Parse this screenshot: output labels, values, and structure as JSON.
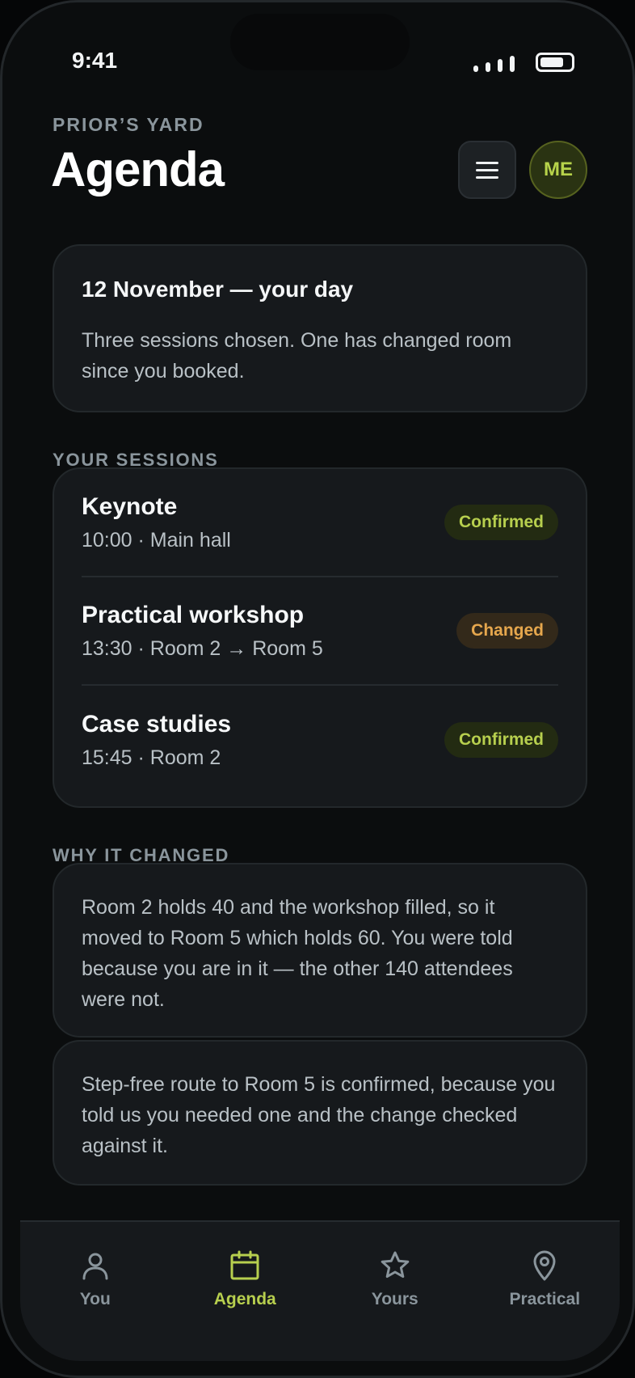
{
  "status_bar": {
    "time": "9:41"
  },
  "header": {
    "eyebrow": "PRIOR’S YARD",
    "title": "Agenda",
    "avatar_initials": "ME"
  },
  "summary": {
    "title": "12 November — your day",
    "text": "Three sessions chosen. One has changed room since you booked."
  },
  "sessions_section": {
    "label": "YOUR SESSIONS",
    "items": [
      {
        "name": "Keynote",
        "meta": "10:00 · Main hall",
        "status": "Confirmed",
        "status_type": "confirmed"
      },
      {
        "name": "Practical workshop",
        "meta": "13:30 · Room 2 → Room 5",
        "status": "Changed",
        "status_type": "changed"
      },
      {
        "name": "Case studies",
        "meta": "15:45 · Room 2",
        "status": "Confirmed",
        "status_type": "confirmed"
      }
    ]
  },
  "why_section": {
    "label": "WHY IT CHANGED",
    "notes": [
      "Room 2 holds 40 and the workshop filled, so it moved to Room 5 which holds 60. You were told because you are in it — the other 140 attendees were not.",
      "Step-free route to Room 5 is confirmed, because you told us you needed one and the change checked against it."
    ]
  },
  "tab_bar": {
    "tabs": [
      {
        "label": "You",
        "icon": "person-icon",
        "active": false
      },
      {
        "label": "Agenda",
        "icon": "calendar-icon",
        "active": true
      },
      {
        "label": "Yours",
        "icon": "star-icon",
        "active": false
      },
      {
        "label": "Practical",
        "icon": "map-pin-icon",
        "active": false
      }
    ]
  },
  "colors": {
    "background": "#0b0d0e",
    "card": "#16191c",
    "accent": "#b7cf4e",
    "warning": "#e6a74d",
    "muted": "#8a959c"
  }
}
